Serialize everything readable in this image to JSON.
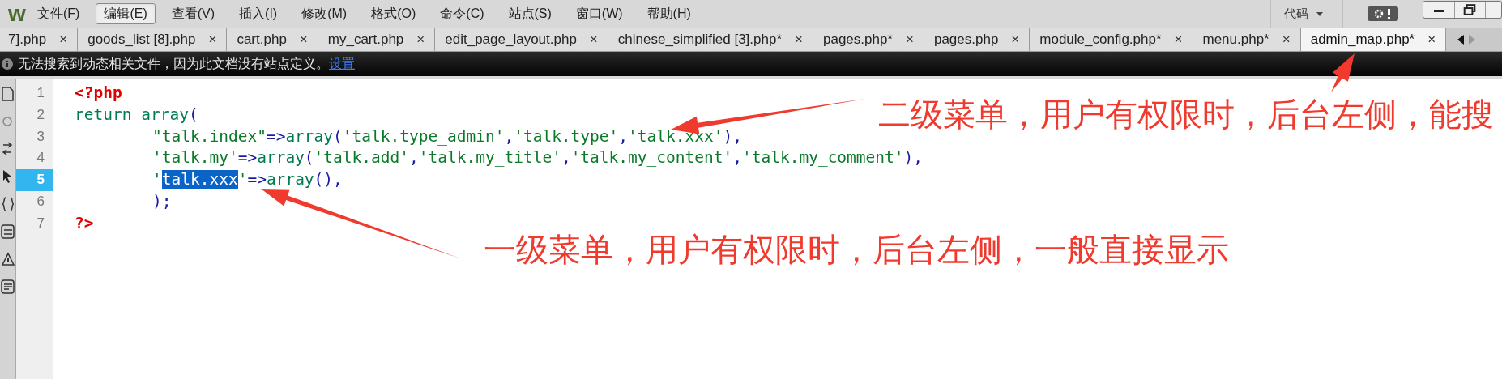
{
  "app": {
    "logo": "w"
  },
  "menu": [
    {
      "label": "文件(F)",
      "selected": false
    },
    {
      "label": "编辑(E)",
      "selected": true
    },
    {
      "label": "查看(V)",
      "selected": false
    },
    {
      "label": "插入(I)",
      "selected": false
    },
    {
      "label": "修改(M)",
      "selected": false
    },
    {
      "label": "格式(O)",
      "selected": false
    },
    {
      "label": "命令(C)",
      "selected": false
    },
    {
      "label": "站点(S)",
      "selected": false
    },
    {
      "label": "窗口(W)",
      "selected": false
    },
    {
      "label": "帮助(H)",
      "selected": false
    }
  ],
  "view_switch": {
    "label": "代码"
  },
  "tabs": [
    {
      "label": "7].php",
      "selected": false
    },
    {
      "label": "goods_list [8].php",
      "selected": false
    },
    {
      "label": "cart.php",
      "selected": false
    },
    {
      "label": "my_cart.php",
      "selected": false
    },
    {
      "label": "edit_page_layout.php",
      "selected": false
    },
    {
      "label": "chinese_simplified [3].php*",
      "selected": false
    },
    {
      "label": "pages.php*",
      "selected": false
    },
    {
      "label": "pages.php",
      "selected": false
    },
    {
      "label": "module_config.php*",
      "selected": false
    },
    {
      "label": "menu.php*",
      "selected": false
    },
    {
      "label": "admin_map.php*",
      "selected": true
    }
  ],
  "tab_close": "×",
  "info_bar": {
    "message": "无法搜索到动态相关文件，因为此文档没有站点定义。",
    "link": "设置"
  },
  "code_lines": [
    {
      "number": "1",
      "current": false,
      "indent": false,
      "tokens": [
        {
          "kind": "tag",
          "text": "<?php"
        }
      ]
    },
    {
      "number": "2",
      "current": false,
      "indent": false,
      "tokens": [
        {
          "kind": "keyword",
          "text": "return array"
        },
        {
          "kind": "punct",
          "text": "("
        }
      ]
    },
    {
      "number": "3",
      "current": false,
      "indent": true,
      "tokens": [
        {
          "kind": "string",
          "text": "\"talk.index\""
        },
        {
          "kind": "punct",
          "text": "=>"
        },
        {
          "kind": "keyword",
          "text": "array"
        },
        {
          "kind": "punct",
          "text": "("
        },
        {
          "kind": "string",
          "text": "'talk.type_admin'"
        },
        {
          "kind": "punct",
          "text": ","
        },
        {
          "kind": "string",
          "text": "'talk.type'"
        },
        {
          "kind": "punct",
          "text": ","
        },
        {
          "kind": "string",
          "text": "'talk.xxx'"
        },
        {
          "kind": "punct",
          "text": "),"
        }
      ]
    },
    {
      "number": "4",
      "current": false,
      "indent": true,
      "tokens": [
        {
          "kind": "string",
          "text": "'talk.my'"
        },
        {
          "kind": "punct",
          "text": "=>"
        },
        {
          "kind": "keyword",
          "text": "array"
        },
        {
          "kind": "punct",
          "text": "("
        },
        {
          "kind": "string",
          "text": "'talk.add'"
        },
        {
          "kind": "punct",
          "text": ","
        },
        {
          "kind": "string",
          "text": "'talk.my_title'"
        },
        {
          "kind": "punct",
          "text": ","
        },
        {
          "kind": "string",
          "text": "'talk.my_content'"
        },
        {
          "kind": "punct",
          "text": ","
        },
        {
          "kind": "string",
          "text": "'talk.my_comment'"
        },
        {
          "kind": "punct",
          "text": "),"
        }
      ]
    },
    {
      "number": "5",
      "current": true,
      "indent": true,
      "tokens": [
        {
          "kind": "string",
          "text": "'"
        },
        {
          "kind": "selection",
          "text": "talk.xxx"
        },
        {
          "kind": "string",
          "text": "'"
        },
        {
          "kind": "punct",
          "text": "=>"
        },
        {
          "kind": "keyword",
          "text": "array"
        },
        {
          "kind": "punct",
          "text": "(),"
        }
      ]
    },
    {
      "number": "6",
      "current": false,
      "indent": true,
      "tokens": [
        {
          "kind": "punct",
          "text": ");"
        }
      ]
    },
    {
      "number": "7",
      "current": false,
      "indent": false,
      "tokens": [
        {
          "kind": "tag",
          "text": "?>"
        }
      ]
    }
  ],
  "annotations": [
    {
      "text": "二级菜单，用户有权限时，后台左侧，能搜"
    },
    {
      "text": "一级菜单，用户有权限时，后台左侧，一般直接显示"
    }
  ]
}
